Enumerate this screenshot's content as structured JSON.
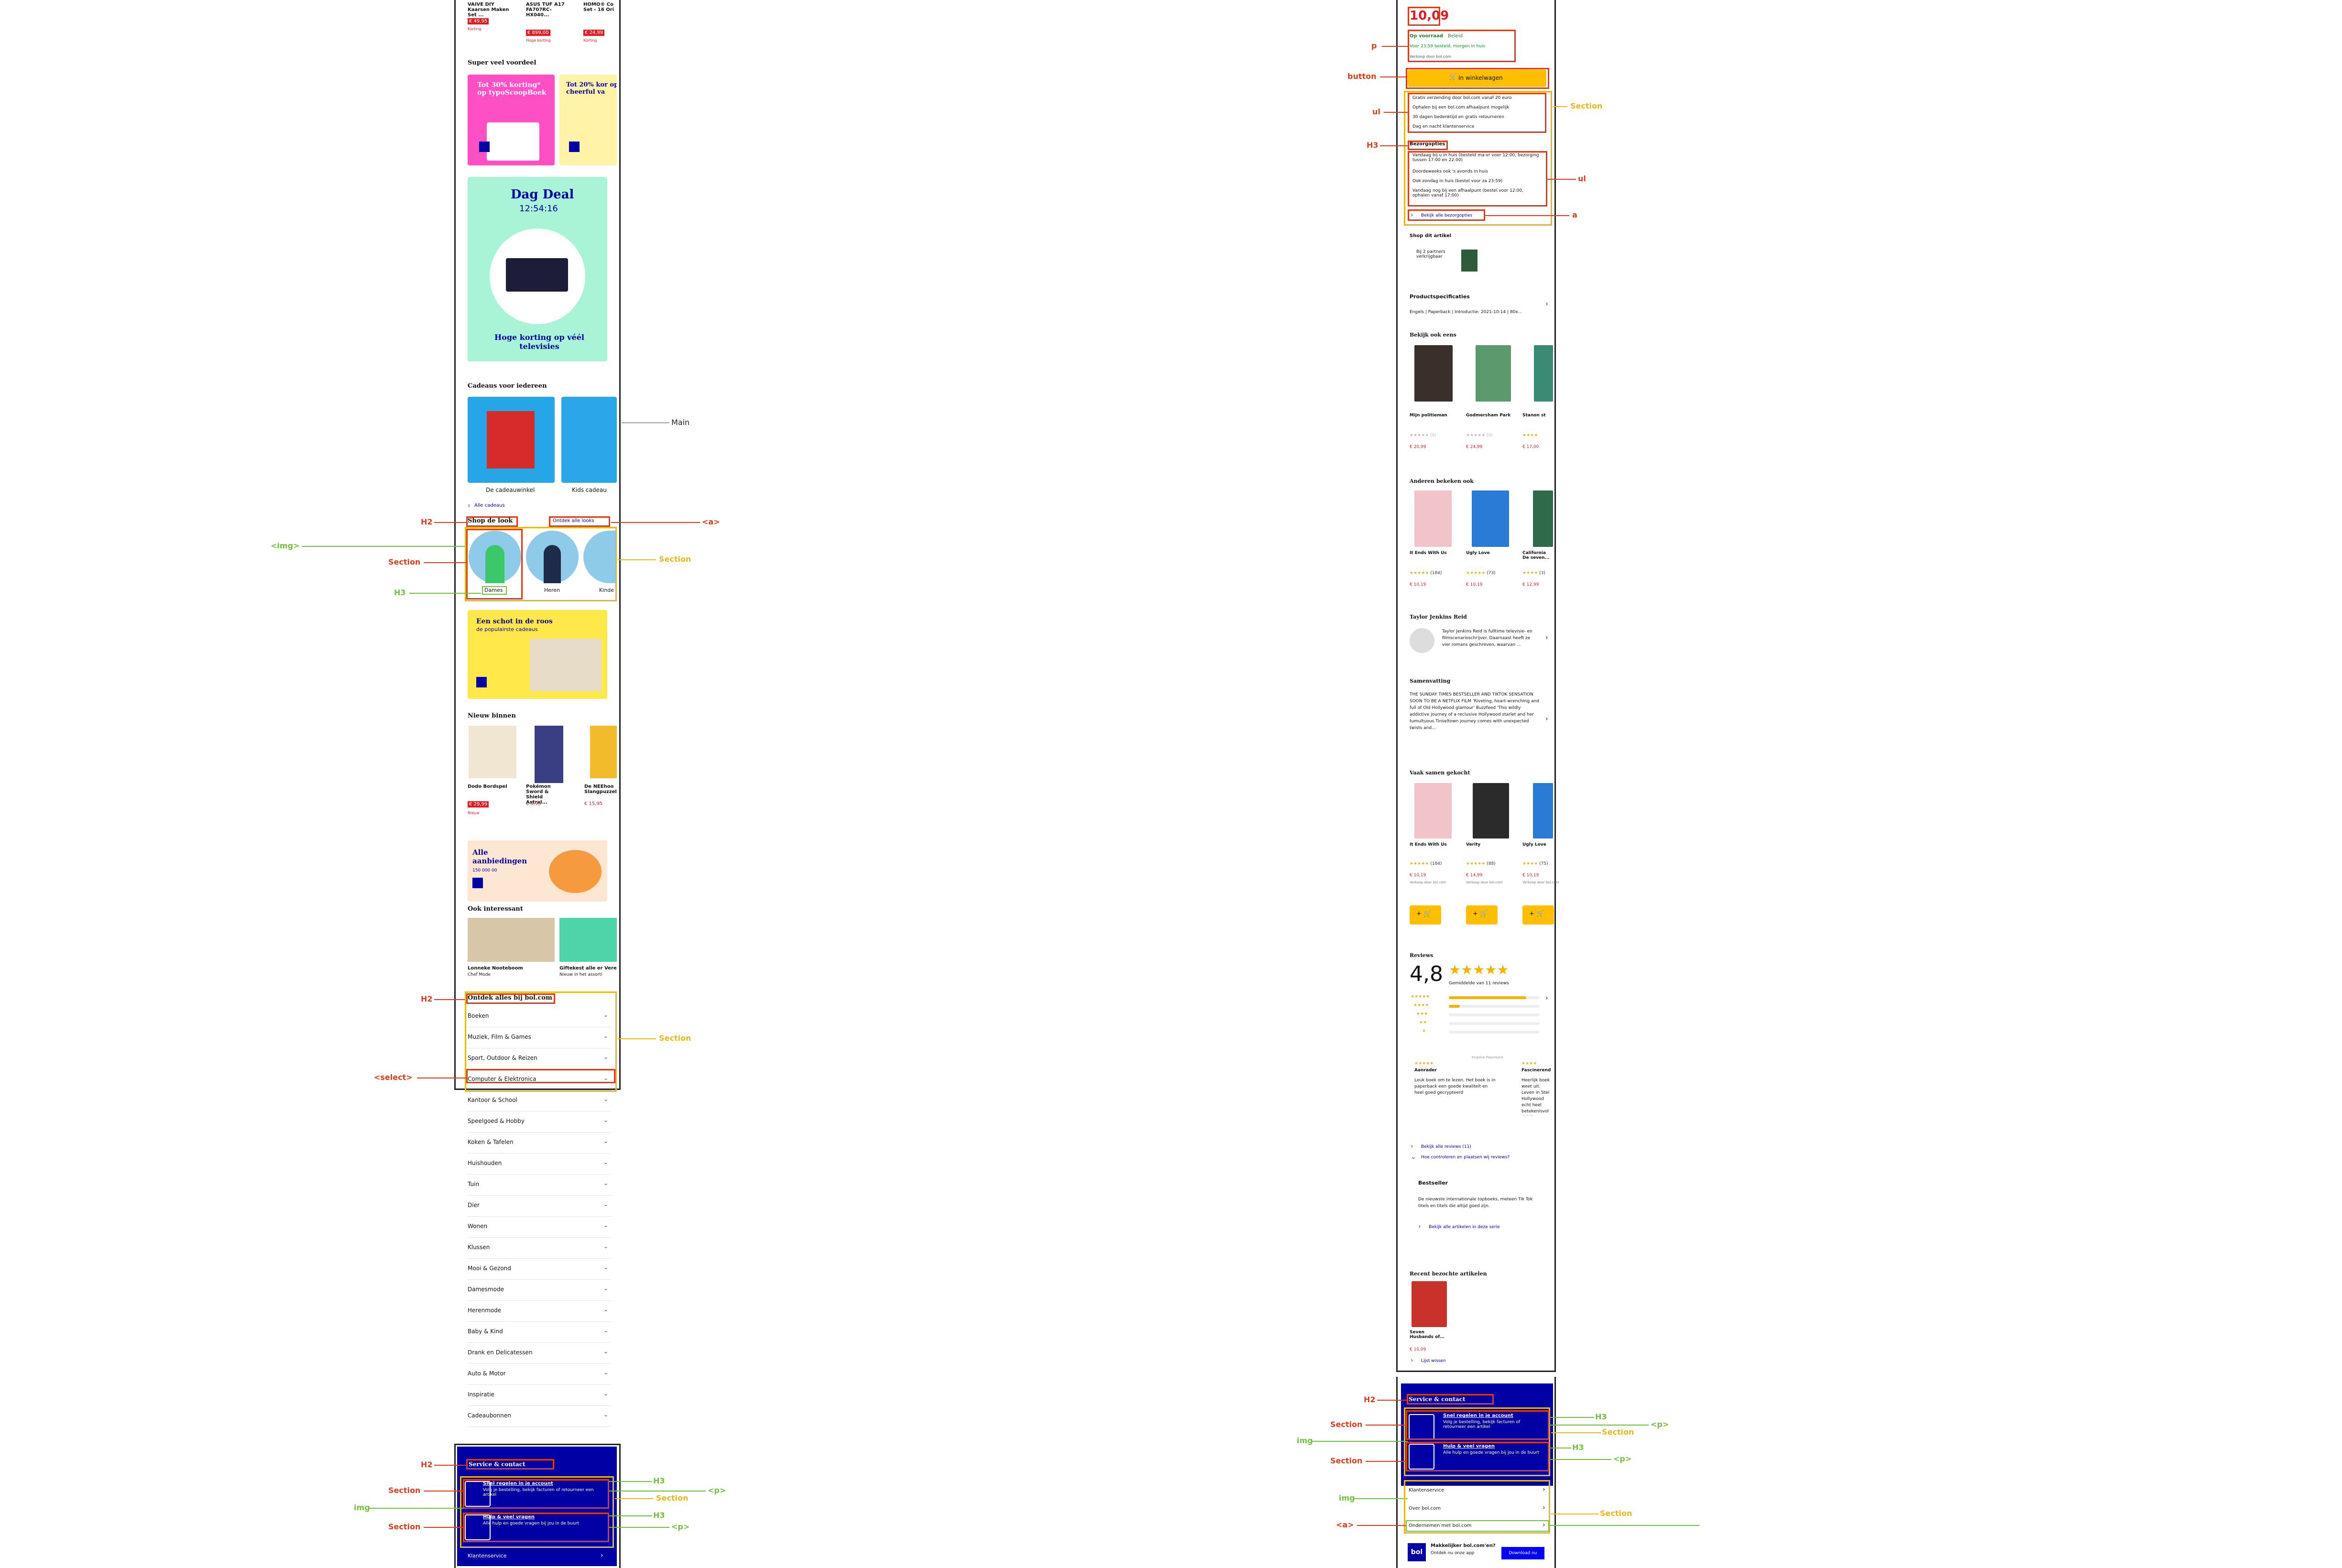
{
  "colors": {
    "accent_red": "#e03a17",
    "section_yellow": "#e8b71a",
    "inner_green": "#6fc23a",
    "bol_blue": "#0000a4",
    "bol_yellow": "#ffbf00",
    "price_red": "#e11b22"
  },
  "left": {
    "top_products": [
      {
        "name": "VAIVE DIY Kaarsen Maken Set ...",
        "price": "€ 49,95",
        "note": "Korting"
      },
      {
        "name": "ASUS TUF A17 FA707RC-HX040...",
        "price": "€ 899,00",
        "note": "Hoge korting"
      },
      {
        "name": "HOMO® Co Set - 16 Ori",
        "price": "€ 24,99",
        "note": "Korting"
      }
    ],
    "super_veel_voordeel": "Super veel voordeel",
    "promo1": "Tot 30% korting* op typoScoopBoek",
    "promo2": "Tot 20% kor op cheerful va",
    "dagdeal_title": "Dag Deal",
    "dagdeal_time": "12:54:16",
    "dagdeal_caption": "Hoge korting op véél televisies",
    "cadeaus_title": "Cadeaus voor iedereen",
    "cadeau1": "De cadeauwinkel",
    "cadeau2": "Kids cadeau",
    "alle_cadeaus": "Alle cadeaus",
    "shop_look_title": "Shop de look",
    "shop_look_link": "Ontdek alle looks",
    "look_items": [
      "Dames",
      "Heren",
      "Kinde"
    ],
    "schot_title": "Een schot in de roos",
    "schot_sub": "de populairste cadeaus",
    "nieuw_title": "Nieuw binnen",
    "nieuw_items": [
      {
        "name": "Dodo Bordspel",
        "price": "€ 29,99",
        "tag": "Nieuw"
      },
      {
        "name": "Pokémon Sword & Shield Astral...",
        "price": "€ 5,95",
        "tag": ""
      },
      {
        "name": "De NEEhoo Slangpuzzel",
        "price": "€ 15,95",
        "tag": ""
      }
    ],
    "aanbiedingen_title": "Alle aanbiedingen",
    "aanbiedingen_count": "150 000 00",
    "interessant_title": "Ook interessant",
    "interessant_items": [
      {
        "name": "Lonneke Nooteboom",
        "sub": "Chef Mode"
      },
      {
        "name": "Giftekest alle er Vere",
        "sub": "Nieuw in het assorti"
      }
    ],
    "ontdek_title": "Ontdek alles bij bol.com",
    "categories": [
      "Boeken",
      "Muziek, Film & Games",
      "Sport, Outdoor & Reizen",
      "Computer & Elektronica",
      "Kantoor & School",
      "Speelgoed & Hobby",
      "Koken & Tafelen",
      "Huishouden",
      "Tuin",
      "Dier",
      "Wonen",
      "Klussen",
      "Mooi & Gezond",
      "Damesmode",
      "Herenmode",
      "Baby & Kind",
      "Drank en Delicatessen",
      "Auto & Motor",
      "Inspiratie",
      "Cadeaubonnen"
    ],
    "service_title": "Service & contact",
    "service_items": [
      {
        "title": "Snel regelen in je account",
        "desc": "Volg je bestelling, bekijk facturen of retourneer een artikel"
      },
      {
        "title": "Hulp & veel vragen",
        "desc": "Alle hulp en goede vragen bij jou in de buurt"
      }
    ],
    "klantenservice": "Klantenservice"
  },
  "right": {
    "price": "10,09",
    "stock": "Op voorraad",
    "stock_extra": "Beleid",
    "delivery": "Voor 23:59 besteld, morgen in huis",
    "verkoop": "Verkoop door bol.com",
    "cart_button": "In winkelwagen",
    "usps": [
      "Gratis verzending door bol.com vanaf 20 euro",
      "Ophalen bij een bol.com afhaalpunt mogelijk",
      "30 dagen bedenktijd en gratis retourneren",
      "Dag en nacht klantenservice"
    ],
    "bezorg_title": "Bezorgopties",
    "bezorg_items": [
      "Vandaag bij u in huis (besteld ma-vr voor 12:00, bezorging tussen 17:00 en 22:00)",
      "Doordeweeks ook 's avonds in huis",
      "Ook zondag in huis (bestel voor za 23:59)",
      "Vandaag nog bij een afhaalpunt (bestel voor 12:00, ophalen vanaf 17:00)"
    ],
    "bezorg_link": "Bekijk alle bezorgopties",
    "shop_artikel": "Shop dit artikel",
    "partners": "Bij 2 partners verkrijgbaar",
    "specs_title": "Productspecificaties",
    "specs_value": "Engels | Paperback | Introductie: 2021-10-14 | 80x...",
    "bekijk_title": "Bekijk ook eens",
    "bekijk_items": [
      {
        "name": "Mijn politieman",
        "price": "€ 20,99",
        "rating": "(0)"
      },
      {
        "name": "Godmersham Park",
        "price": "€ 24,99",
        "rating": "(0)"
      },
      {
        "name": "Stanon st",
        "price": "€ 17,00",
        "rating": ""
      }
    ],
    "anderen_title": "Anderen bekeken ook",
    "anderen_items": [
      {
        "name": "It Ends With Us",
        "price": "€ 10,19",
        "rating": "(184)"
      },
      {
        "name": "Ugly Love",
        "price": "€ 10,19",
        "rating": "(73)"
      },
      {
        "name": "California De seven...",
        "price": "€ 12,99",
        "rating": "(3)"
      }
    ],
    "auteur_title": "Taylor Jenkins Reid",
    "auteur_desc": "Taylor Jenkins Reid is fulltime televisie- en filmscenarioschrijver. Daarnaast heeft ze vier romans geschreven, waarvan ...",
    "samenvatting_title": "Samenvatting",
    "samenvatting_text": "THE SUNDAY TIMES BESTSELLER AND TIKTOK SENSATION SOON TO BE A NETFLIX FILM 'Riveting, heart-wrenching and full of Old Hollywood glamour' Buzzfeed 'This wildly addictive journey of a reclusive Hollywood starlet and her tumultuous Tinseltown journey comes with unexpected twists and...",
    "vaak_title": "Vaak samen gekocht",
    "vaak_items": [
      {
        "name": "It Ends With Us",
        "price": "€ 10,19",
        "rating": "(184)",
        "seller": "Verkoop door bol.com"
      },
      {
        "name": "Verity",
        "price": "€ 14,99",
        "rating": "(88)",
        "seller": "Verkoop door bol.com"
      },
      {
        "name": "Ugly Love",
        "price": "€ 10,19",
        "rating": "(75)",
        "seller": "Verkoop door bol.com"
      }
    ],
    "reviews_title": "Reviews",
    "reviews_score": "4,8",
    "reviews_sub": "Gemiddelde van 11 reviews",
    "review_star_fill": [
      0.85,
      0.12,
      0,
      0,
      0
    ],
    "review_cards": [
      {
        "author": "Aanrader",
        "text": "Leuk boek om te lezen. Het boek is in paperback een goede kwaliteit en heel goed gecrypteerd",
        "meta": "Engelse Paperback"
      },
      {
        "author": "Fascinerend",
        "text": "Heerlijk boek weet uit. Leven in Stel Hollywood echt heel betekenisvol WOW",
        "meta": ""
      }
    ],
    "reviews_links": [
      "Bekijk alle reviews (11)",
      "Hoe controleren en plaatsen wij reviews?"
    ],
    "bestseller_title": "Bestseller",
    "bestseller_text": "De nieuwste internationale topboeks, meteen Tik Tok titels en titels die altijd goed zijn.",
    "bestseller_link": "Bekijk alle artikelen in deze serie",
    "recent_title": "Recent bezochte artikelen",
    "recent_item": {
      "name": "Seven Husbands of...",
      "price": "€ 10,09"
    },
    "recent_link": "Lijst wissen",
    "service_title": "Service & contact",
    "service_items": [
      {
        "title": "Snel regelen in je account",
        "desc": "Volg je bestelling, bekijk facturen of retourneer een artikel"
      },
      {
        "title": "Hulp & veel vragen",
        "desc": "Alle hulp en goede vragen bij jou in de buurt"
      }
    ],
    "service_links": [
      "Klantenservice",
      "Over bol.com",
      "Ondernemen met bol.com"
    ],
    "app_title": "Makkelijker bol.com'en?",
    "app_sub": "Ontdek nu onze app",
    "app_button": "Download nu"
  },
  "annotations": {
    "main": "Main",
    "h2": "H2",
    "a_tag": "<a>",
    "img_tag": "<img>",
    "section": "Section",
    "h3": "H3",
    "select_tag": "<select>",
    "img": "img",
    "p_tag": "<p>",
    "p": "p",
    "button": "button",
    "ul": "ul",
    "a": "a"
  }
}
